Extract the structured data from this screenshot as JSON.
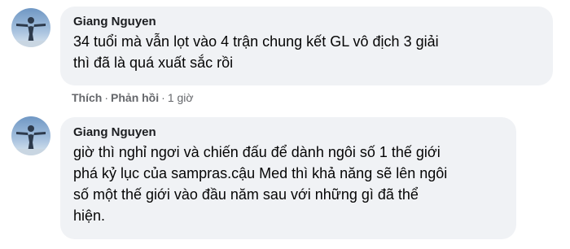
{
  "comments": [
    {
      "author": "Giang Nguyen",
      "lines": [
        "34 tuổi mà vẫn lọt vào 4 trận chung kết GL vô địch 3 giải",
        "thì đã là quá xuất sắc rồi"
      ],
      "actions": {
        "like": "Thích",
        "reply": "Phản hồi",
        "time": "1 giờ",
        "separator": "·"
      }
    },
    {
      "author": "Giang Nguyen",
      "lines": [
        "giờ thì nghỉ ngơi và chiến đấu để dành ngôi số 1 thế giới",
        "phá kỷ lục của sampras.cậu Med thì khả năng sẽ lên ngôi",
        "số một thế giới vào đầu năm sau với những gì đã thể",
        "hiện."
      ]
    }
  ],
  "colors": {
    "bubble": "#f0f2f5",
    "author": "#1c1e21",
    "text": "#050505",
    "meta": "#65676b",
    "avatar_sky": "#8eb2d6"
  },
  "icons": {
    "avatar": "user-avatar-photo"
  }
}
